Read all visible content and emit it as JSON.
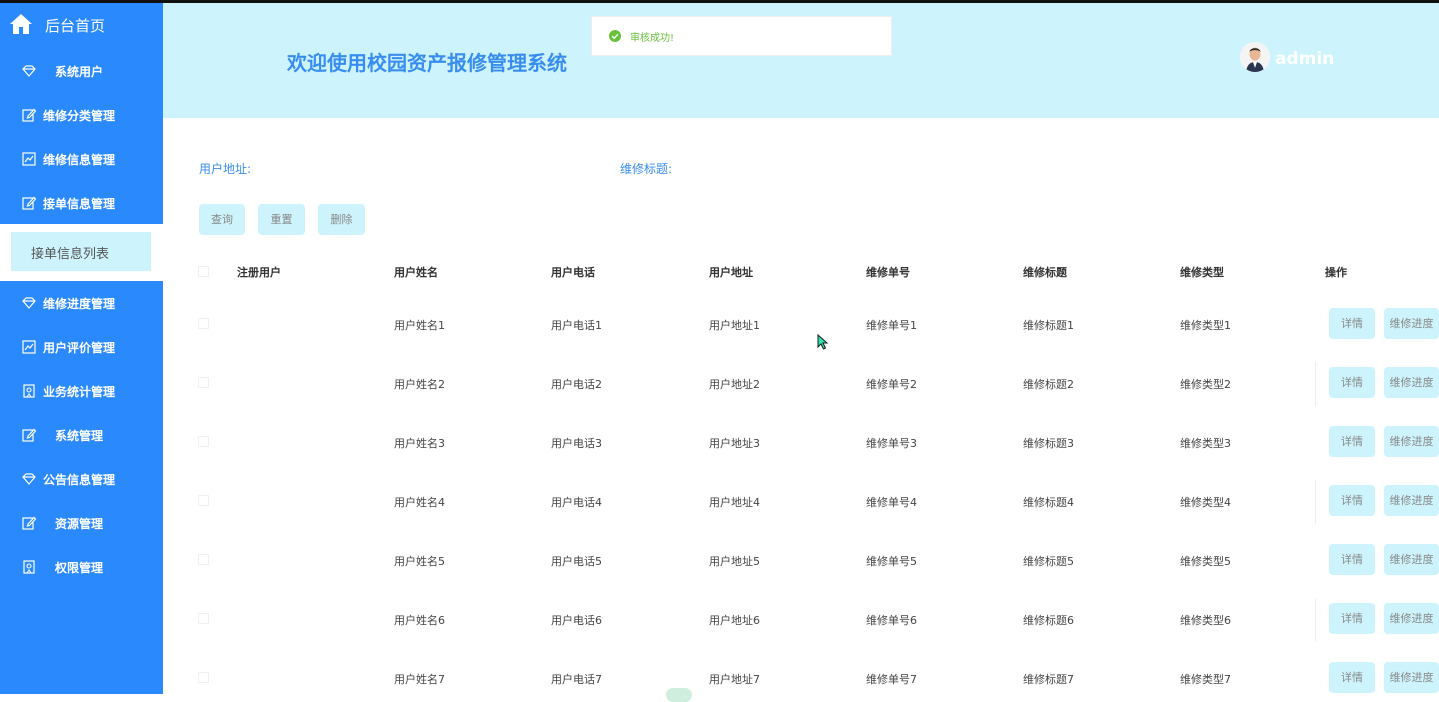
{
  "sidebar": {
    "home_label": "后台首页",
    "items": [
      {
        "label": "系统用户",
        "icon": "diamond-icon"
      },
      {
        "label": "维修分类管理",
        "icon": "edit-icon"
      },
      {
        "label": "维修信息管理",
        "icon": "chart-icon"
      },
      {
        "label": "接单信息管理",
        "icon": "edit-icon"
      },
      {
        "label": "维修进度管理",
        "icon": "diamond-icon"
      },
      {
        "label": "用户评价管理",
        "icon": "chart-icon"
      },
      {
        "label": "业务统计管理",
        "icon": "badge-icon"
      },
      {
        "label": "系统管理",
        "icon": "edit-icon"
      },
      {
        "label": "公告信息管理",
        "icon": "diamond-icon"
      },
      {
        "label": "资源管理",
        "icon": "edit-icon"
      },
      {
        "label": "权限管理",
        "icon": "badge-icon"
      }
    ],
    "submenu_label": "接单信息列表"
  },
  "header": {
    "title": "欢迎使用校园资产报修管理系统",
    "username": "admin"
  },
  "toast": {
    "message": "审核成功!"
  },
  "search": {
    "address_label": "用户地址:",
    "title_label": "维修标题:"
  },
  "actions": {
    "query": "查询",
    "reset": "重置",
    "delete": "删除"
  },
  "table": {
    "headers": [
      "注册用户",
      "用户姓名",
      "用户电话",
      "用户地址",
      "维修单号",
      "维修标题",
      "维修类型",
      "操作"
    ],
    "rows": [
      {
        "name": "用户姓名1",
        "phone": "用户电话1",
        "address": "用户地址1",
        "order_no": "维修单号1",
        "title": "维修标题1",
        "type": "维修类型1"
      },
      {
        "name": "用户姓名2",
        "phone": "用户电话2",
        "address": "用户地址2",
        "order_no": "维修单号2",
        "title": "维修标题2",
        "type": "维修类型2"
      },
      {
        "name": "用户姓名3",
        "phone": "用户电话3",
        "address": "用户地址3",
        "order_no": "维修单号3",
        "title": "维修标题3",
        "type": "维修类型3"
      },
      {
        "name": "用户姓名4",
        "phone": "用户电话4",
        "address": "用户地址4",
        "order_no": "维修单号4",
        "title": "维修标题4",
        "type": "维修类型4"
      },
      {
        "name": "用户姓名5",
        "phone": "用户电话5",
        "address": "用户地址5",
        "order_no": "维修单号5",
        "title": "维修标题5",
        "type": "维修类型5"
      },
      {
        "name": "用户姓名6",
        "phone": "用户电话6",
        "address": "用户地址6",
        "order_no": "维修单号6",
        "title": "维修标题6",
        "type": "维修类型6"
      },
      {
        "name": "用户姓名7",
        "phone": "用户电话7",
        "address": "用户地址7",
        "order_no": "维修单号7",
        "title": "维修标题7",
        "type": "维修类型7"
      }
    ],
    "detail_label": "详情",
    "progress_label": "维修进度"
  },
  "colors": {
    "sidebar": "#2a89fc",
    "header": "#cdf4fc",
    "accent": "#3a8df0",
    "button": "#cdf4fc",
    "success": "#67c23a"
  }
}
